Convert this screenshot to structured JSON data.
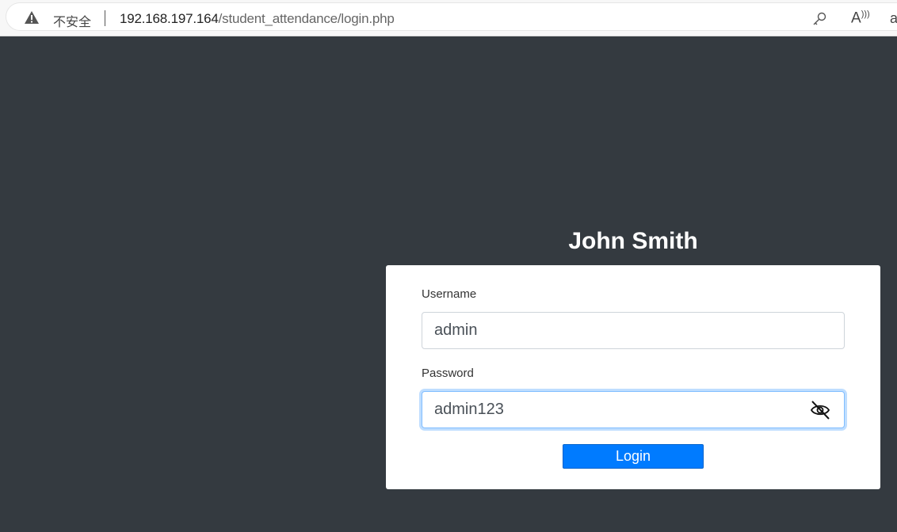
{
  "browser": {
    "security_label": "不安全",
    "url_host": "192.168.197.164",
    "url_path": "/student_attendance/login.php",
    "icons": [
      "warning-icon",
      "key-icon",
      "read-aloud-icon",
      "text-size-icon"
    ],
    "read_aloud_glyph": "A",
    "text_size_glyph": "aa"
  },
  "brand": {
    "title": "John Smith"
  },
  "login_form": {
    "username_label": "Username",
    "username_value": "admin",
    "password_label": "Password",
    "password_value": "admin123",
    "password_visibility_icon": "eye-slash-icon",
    "submit_label": "Login"
  },
  "colors": {
    "page_background": "#343a40",
    "card_background": "#ffffff",
    "button_primary": "#007bff",
    "focus_ring": "#80bdff"
  }
}
